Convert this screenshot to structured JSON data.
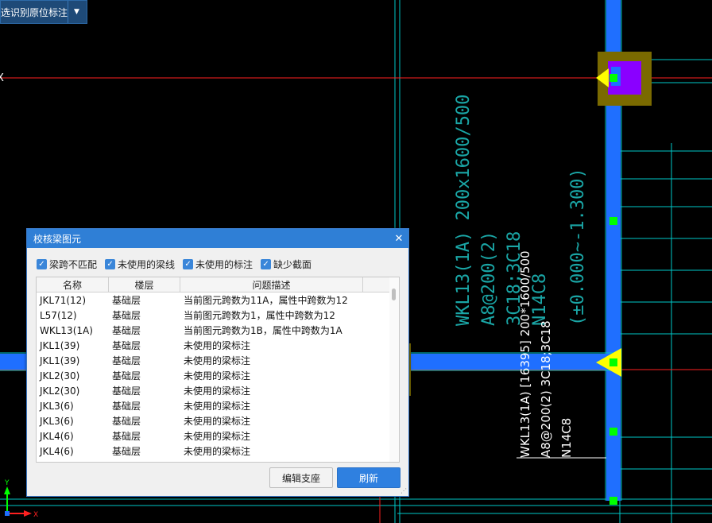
{
  "toolbar": {
    "label": "选识别原位标注",
    "dropdown_glyph": "▼"
  },
  "cad": {
    "left_mark": "X",
    "vertical_text_upper": [
      "WKL13(1A) 200x1600/500",
      "A8@200(2)",
      "3C18;3C18",
      "N14C8",
      "(±0.000~-1.300)"
    ],
    "vertical_text_white": [
      "WKL13(1A) [16395] 200*1600/500",
      "A8@200(2) 3C18;3C18",
      "N14C8"
    ],
    "axis": {
      "y": "Y",
      "x": "X"
    },
    "colors": {
      "beam": "#1f6fff",
      "grid": "#00c8c8",
      "axis_red": "#ff2020",
      "text_teal": "#1aa6a6",
      "column": "#8a00ff",
      "support": "#ffff00",
      "node": "#00ff00"
    }
  },
  "dialog": {
    "title": "校核梁图元",
    "close_glyph": "✕",
    "checkboxes": [
      {
        "label": "梁跨不匹配",
        "checked": true
      },
      {
        "label": "未使用的梁线",
        "checked": true
      },
      {
        "label": "未使用的标注",
        "checked": true
      },
      {
        "label": "缺少截面",
        "checked": true
      }
    ],
    "columns": [
      "名称",
      "楼层",
      "问题描述"
    ],
    "rows": [
      [
        "JKL71(12)",
        "基础层",
        "当前图元跨数为11A，属性中跨数为12"
      ],
      [
        "L57(12)",
        "基础层",
        "当前图元跨数为1，属性中跨数为12"
      ],
      [
        "WKL13(1A)",
        "基础层",
        "当前图元跨数为1B，属性中跨数为1A"
      ],
      [
        "JKL1(39)",
        "基础层",
        "未使用的梁标注"
      ],
      [
        "JKL1(39)",
        "基础层",
        "未使用的梁标注"
      ],
      [
        "JKL2(30)",
        "基础层",
        "未使用的梁标注"
      ],
      [
        "JKL2(30)",
        "基础层",
        "未使用的梁标注"
      ],
      [
        "JKL3(6)",
        "基础层",
        "未使用的梁标注"
      ],
      [
        "JKL3(6)",
        "基础层",
        "未使用的梁标注"
      ],
      [
        "JKL4(6)",
        "基础层",
        "未使用的梁标注"
      ],
      [
        "JKL4(6)",
        "基础层",
        "未使用的梁标注"
      ]
    ],
    "buttons": {
      "edit": "编辑支座",
      "refresh": "刷新"
    }
  }
}
